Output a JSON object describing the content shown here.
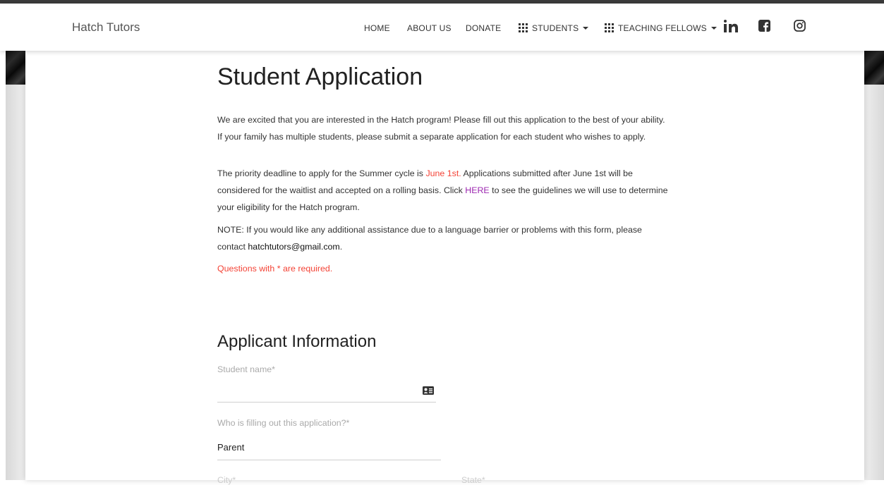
{
  "nav": {
    "brand": "Hatch Tutors",
    "home": "HOME",
    "about": "ABOUT US",
    "donate": "DONATE",
    "students": "STUDENTS",
    "teaching_fellows": "TEACHING FELLOWS",
    "social_icons": [
      "linkedin-icon",
      "facebook-icon",
      "instagram-icon"
    ]
  },
  "page": {
    "title": "Student Application",
    "intro": "We are excited that you are interested in the Hatch program! Please fill out this application to the best of your ability. If your family has multiple students, please submit a separate application for each student who wishes to apply.",
    "deadline_before": "The priority deadline to apply for the Summer cycle is ",
    "deadline_date": "June 1st.",
    "deadline_after": " Applications submitted after June 1st will be considered for the waitlist and accepted on a rolling basis. Click ",
    "deadline_link": "HERE",
    "deadline_end": " to see the guidelines we will use to determine your eligibility for the Hatch program.",
    "note_before": "NOTE: If you would like any additional assistance due to a language barrier or problems with this form, please contact ",
    "note_email": "hatchtutors@gmail.com",
    "note_after": ".",
    "required_note": "Questions with * are required."
  },
  "section": {
    "title": "Applicant Information"
  },
  "form": {
    "student_name_label": "Student name*",
    "student_name_value": "",
    "filler_label": "Who is filling out this application?*",
    "filler_value": "Parent",
    "city_label": "City*",
    "state_label": "State*"
  },
  "colors": {
    "required": "#f44336",
    "link": "#9c27b0"
  }
}
